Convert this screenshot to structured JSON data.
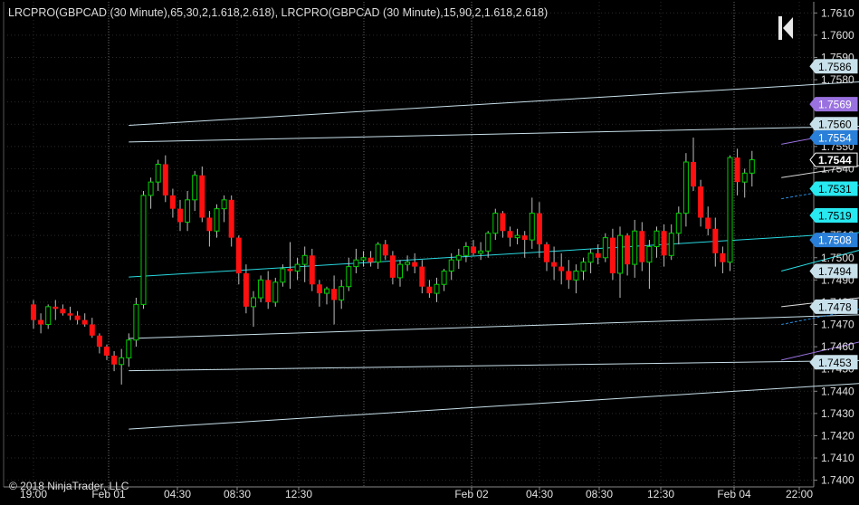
{
  "indicator_label": "LRCPRO(GBPCAD (30 Minute),65,30,2,1.618,2.618), LRCPRO(GBPCAD (30 Minute),15,90,2,1.618,2.618)",
  "copyright": "© 2018 NinjaTrader, LLC",
  "colors": {
    "background": "#000000",
    "grid": "#2a2a2a",
    "up_candle": "#00d000",
    "down_candle": "#ff1010",
    "long_channel": "#c8e0ea",
    "long_center": "#28d8e0",
    "short_outer": "#9a72e0",
    "short_inner": "#d8d8d8",
    "short_dashed": "#2a8ee0",
    "short_center": "#28e0e8"
  },
  "chart_data": {
    "type": "candlestick",
    "instrument": "GBPCAD",
    "timeframe": "30 Minute",
    "y_ticks": [
      "1.7610",
      "1.7600",
      "1.7590",
      "1.7580",
      "1.7570",
      "1.7560",
      "1.7550",
      "1.7540",
      "1.7530",
      "1.7520",
      "1.7510",
      "1.7500",
      "1.7490",
      "1.7480",
      "1.7470",
      "1.7460",
      "1.7450",
      "1.7440",
      "1.7430",
      "1.7420",
      "1.7410",
      "1.7400"
    ],
    "ylim": [
      1.7397,
      1.7615
    ],
    "x_ticks": [
      "19:00",
      "Feb 01",
      "04:30",
      "08:30",
      "12:30",
      "Feb 02",
      "04:30",
      "08:30",
      "12:30",
      "Feb 04",
      "22:00"
    ],
    "price_markers": [
      {
        "label": "1.7586",
        "value": 1.7586,
        "bg": "#c8e0ea",
        "fg": "#000000"
      },
      {
        "label": "1.7569",
        "value": 1.7569,
        "bg": "#9a72e0",
        "fg": "#ffffff"
      },
      {
        "label": "1.7560",
        "value": 1.756,
        "bg": "#c8e0ea",
        "fg": "#000000"
      },
      {
        "label": "1.7554",
        "value": 1.7554,
        "bg": "#2a7fd8",
        "fg": "#ffffff"
      },
      {
        "label": "1.7544",
        "value": 1.7544,
        "bg": "#000000",
        "fg": "#ffffff",
        "border": "#ffffff"
      },
      {
        "label": "1.7531",
        "value": 1.7531,
        "bg": "#28e8f0",
        "fg": "#000000"
      },
      {
        "label": "1.7519",
        "value": 1.7519,
        "bg": "#28e8f0",
        "fg": "#000000"
      },
      {
        "label": "1.7508",
        "value": 1.7508,
        "bg": "#2a7fd8",
        "fg": "#ffffff"
      },
      {
        "label": "1.7494",
        "value": 1.7494,
        "bg": "#c8e0ea",
        "fg": "#000000"
      },
      {
        "label": "1.7478",
        "value": 1.7478,
        "bg": "#c8e0ea",
        "fg": "#000000"
      },
      {
        "label": "1.7453",
        "value": 1.7453,
        "bg": "#c8e0ea",
        "fg": "#000000"
      }
    ],
    "channels": [
      {
        "name": "",
        "group": "long",
        "role": "upper2",
        "style": "solid",
        "from": [
          13,
          1.75595
        ],
        "to": [
          161,
          1.75885
        ]
      },
      {
        "name": "",
        "group": "long",
        "role": "upper1",
        "style": "solid",
        "from": [
          13,
          1.7552
        ],
        "to": [
          161,
          1.75625
        ]
      },
      {
        "name": "",
        "group": "long",
        "role": "center",
        "style": "solid",
        "from": [
          13,
          1.74913
        ],
        "to": [
          161,
          1.7521
        ]
      },
      {
        "name": "",
        "group": "long",
        "role": "lower1",
        "style": "solid",
        "from": [
          13,
          1.74637
        ],
        "to": [
          161,
          1.74795
        ]
      },
      {
        "name": "",
        "group": "long",
        "role": "lower2",
        "style": "solid",
        "from": [
          13,
          1.74492
        ],
        "to": [
          161,
          1.7456
        ]
      },
      {
        "name": "",
        "group": "long",
        "role": "lower3",
        "style": "solid",
        "from": [
          13,
          1.7423
        ],
        "to": [
          161,
          1.74534
        ]
      },
      {
        "name": "",
        "group": "short",
        "role": "upper_outer",
        "style": "solid",
        "from": [
          102,
          1.7551
        ],
        "to": [
          161,
          1.7588
        ]
      },
      {
        "name": "",
        "group": "short",
        "role": "upper_inner",
        "style": "solid",
        "from": [
          102,
          1.7536
        ],
        "to": [
          161,
          1.7566
        ]
      },
      {
        "name": "",
        "group": "short",
        "role": "upper_dashed",
        "style": "dashed",
        "from": [
          102,
          1.75265
        ],
        "to": [
          161,
          1.756
        ]
      },
      {
        "name": "",
        "group": "short",
        "role": "center",
        "style": "solid",
        "from": [
          102,
          1.7494
        ],
        "to": [
          161,
          1.7546
        ]
      },
      {
        "name": "",
        "group": "short",
        "role": "lower_dashed",
        "style": "dashed",
        "from": [
          102,
          1.747
        ],
        "to": [
          161,
          1.7508
        ]
      },
      {
        "name": "",
        "group": "short",
        "role": "lower_inner",
        "style": "solid",
        "from": [
          102,
          1.7478
        ],
        "to": [
          161,
          1.75
        ]
      },
      {
        "name": "",
        "group": "short",
        "role": "lower_outer",
        "style": "solid",
        "from": [
          102,
          1.7454
        ],
        "to": [
          161,
          1.7499
        ]
      }
    ],
    "candles": [
      {
        "o": 1.7479,
        "h": 1.7481,
        "l": 1.7468,
        "c": 1.7472
      },
      {
        "o": 1.7472,
        "h": 1.7475,
        "l": 1.7466,
        "c": 1.747
      },
      {
        "o": 1.747,
        "h": 1.7479,
        "l": 1.7468,
        "c": 1.7478
      },
      {
        "o": 1.7478,
        "h": 1.7481,
        "l": 1.7472,
        "c": 1.7477
      },
      {
        "o": 1.7477,
        "h": 1.7479,
        "l": 1.7474,
        "c": 1.7475
      },
      {
        "o": 1.7475,
        "h": 1.7478,
        "l": 1.7472,
        "c": 1.7474
      },
      {
        "o": 1.7474,
        "h": 1.7476,
        "l": 1.747,
        "c": 1.7472
      },
      {
        "o": 1.7472,
        "h": 1.7475,
        "l": 1.7469,
        "c": 1.747
      },
      {
        "o": 1.747,
        "h": 1.7473,
        "l": 1.7464,
        "c": 1.7465
      },
      {
        "o": 1.7465,
        "h": 1.7466,
        "l": 1.7457,
        "c": 1.746
      },
      {
        "o": 1.746,
        "h": 1.7461,
        "l": 1.7454,
        "c": 1.7456
      },
      {
        "o": 1.7456,
        "h": 1.7458,
        "l": 1.7449,
        "c": 1.7452
      },
      {
        "o": 1.7452,
        "h": 1.7459,
        "l": 1.7443,
        "c": 1.7455
      },
      {
        "o": 1.7455,
        "h": 1.7466,
        "l": 1.7451,
        "c": 1.7463
      },
      {
        "o": 1.7463,
        "h": 1.7482,
        "l": 1.746,
        "c": 1.7479
      },
      {
        "o": 1.7479,
        "h": 1.753,
        "l": 1.7477,
        "c": 1.7528
      },
      {
        "o": 1.7528,
        "h": 1.7536,
        "l": 1.7522,
        "c": 1.7534
      },
      {
        "o": 1.7534,
        "h": 1.7544,
        "l": 1.753,
        "c": 1.7542
      },
      {
        "o": 1.7542,
        "h": 1.7546,
        "l": 1.7525,
        "c": 1.7528
      },
      {
        "o": 1.7528,
        "h": 1.7531,
        "l": 1.7518,
        "c": 1.7522
      },
      {
        "o": 1.7522,
        "h": 1.7526,
        "l": 1.7512,
        "c": 1.7516
      },
      {
        "o": 1.7516,
        "h": 1.753,
        "l": 1.7512,
        "c": 1.7526
      },
      {
        "o": 1.7526,
        "h": 1.7539,
        "l": 1.7521,
        "c": 1.7537
      },
      {
        "o": 1.7537,
        "h": 1.7541,
        "l": 1.7516,
        "c": 1.7518
      },
      {
        "o": 1.7518,
        "h": 1.7521,
        "l": 1.7505,
        "c": 1.7512
      },
      {
        "o": 1.7512,
        "h": 1.7524,
        "l": 1.7509,
        "c": 1.7522
      },
      {
        "o": 1.7522,
        "h": 1.7528,
        "l": 1.7516,
        "c": 1.7526
      },
      {
        "o": 1.7526,
        "h": 1.7528,
        "l": 1.7505,
        "c": 1.7509
      },
      {
        "o": 1.7509,
        "h": 1.751,
        "l": 1.7488,
        "c": 1.7493
      },
      {
        "o": 1.7493,
        "h": 1.7497,
        "l": 1.7475,
        "c": 1.7478
      },
      {
        "o": 1.7478,
        "h": 1.7485,
        "l": 1.7469,
        "c": 1.7482
      },
      {
        "o": 1.7482,
        "h": 1.7492,
        "l": 1.748,
        "c": 1.749
      },
      {
        "o": 1.749,
        "h": 1.7494,
        "l": 1.7477,
        "c": 1.748
      },
      {
        "o": 1.748,
        "h": 1.7491,
        "l": 1.7478,
        "c": 1.7489
      },
      {
        "o": 1.7489,
        "h": 1.7497,
        "l": 1.7487,
        "c": 1.7495
      },
      {
        "o": 1.7495,
        "h": 1.7507,
        "l": 1.7486,
        "c": 1.7494
      },
      {
        "o": 1.7494,
        "h": 1.75,
        "l": 1.749,
        "c": 1.7497
      },
      {
        "o": 1.7497,
        "h": 1.7505,
        "l": 1.7489,
        "c": 1.7501
      },
      {
        "o": 1.7501,
        "h": 1.7504,
        "l": 1.7485,
        "c": 1.7488
      },
      {
        "o": 1.7488,
        "h": 1.749,
        "l": 1.7478,
        "c": 1.7484
      },
      {
        "o": 1.7484,
        "h": 1.7487,
        "l": 1.7479,
        "c": 1.7486
      },
      {
        "o": 1.7486,
        "h": 1.7492,
        "l": 1.747,
        "c": 1.7481
      },
      {
        "o": 1.7481,
        "h": 1.749,
        "l": 1.7477,
        "c": 1.7487
      },
      {
        "o": 1.7487,
        "h": 1.75,
        "l": 1.7485,
        "c": 1.7496
      },
      {
        "o": 1.7496,
        "h": 1.7504,
        "l": 1.7493,
        "c": 1.7499
      },
      {
        "o": 1.7499,
        "h": 1.7503,
        "l": 1.7496,
        "c": 1.75
      },
      {
        "o": 1.75,
        "h": 1.7503,
        "l": 1.7496,
        "c": 1.7498
      },
      {
        "o": 1.7498,
        "h": 1.7507,
        "l": 1.7495,
        "c": 1.7506
      },
      {
        "o": 1.7506,
        "h": 1.7508,
        "l": 1.7499,
        "c": 1.7501
      },
      {
        "o": 1.7501,
        "h": 1.7503,
        "l": 1.7488,
        "c": 1.7491
      },
      {
        "o": 1.7491,
        "h": 1.7499,
        "l": 1.7487,
        "c": 1.7497
      },
      {
        "o": 1.7497,
        "h": 1.7501,
        "l": 1.7494,
        "c": 1.7498
      },
      {
        "o": 1.7498,
        "h": 1.7502,
        "l": 1.7493,
        "c": 1.7496
      },
      {
        "o": 1.7496,
        "h": 1.7499,
        "l": 1.7484,
        "c": 1.7487
      },
      {
        "o": 1.7487,
        "h": 1.749,
        "l": 1.7482,
        "c": 1.7484
      },
      {
        "o": 1.7484,
        "h": 1.7491,
        "l": 1.748,
        "c": 1.7488
      },
      {
        "o": 1.7488,
        "h": 1.7495,
        "l": 1.7485,
        "c": 1.7494
      },
      {
        "o": 1.7494,
        "h": 1.7502,
        "l": 1.749,
        "c": 1.7499
      },
      {
        "o": 1.7499,
        "h": 1.7504,
        "l": 1.7495,
        "c": 1.7501
      },
      {
        "o": 1.7501,
        "h": 1.7507,
        "l": 1.7498,
        "c": 1.7505
      },
      {
        "o": 1.7505,
        "h": 1.7508,
        "l": 1.7501,
        "c": 1.7502
      },
      {
        "o": 1.7502,
        "h": 1.7507,
        "l": 1.7499,
        "c": 1.7503
      },
      {
        "o": 1.7503,
        "h": 1.7512,
        "l": 1.75,
        "c": 1.7511
      },
      {
        "o": 1.7511,
        "h": 1.7522,
        "l": 1.7508,
        "c": 1.752
      },
      {
        "o": 1.752,
        "h": 1.7521,
        "l": 1.7509,
        "c": 1.7512
      },
      {
        "o": 1.7512,
        "h": 1.7514,
        "l": 1.7505,
        "c": 1.7509
      },
      {
        "o": 1.7509,
        "h": 1.7513,
        "l": 1.7506,
        "c": 1.751
      },
      {
        "o": 1.751,
        "h": 1.7512,
        "l": 1.75,
        "c": 1.7508
      },
      {
        "o": 1.7508,
        "h": 1.7527,
        "l": 1.7504,
        "c": 1.752
      },
      {
        "o": 1.752,
        "h": 1.7525,
        "l": 1.75,
        "c": 1.7506
      },
      {
        "o": 1.7506,
        "h": 1.7507,
        "l": 1.7494,
        "c": 1.7498
      },
      {
        "o": 1.7498,
        "h": 1.7505,
        "l": 1.749,
        "c": 1.7496
      },
      {
        "o": 1.7496,
        "h": 1.7502,
        "l": 1.7488,
        "c": 1.7494
      },
      {
        "o": 1.7494,
        "h": 1.7499,
        "l": 1.7486,
        "c": 1.749
      },
      {
        "o": 1.749,
        "h": 1.7497,
        "l": 1.7484,
        "c": 1.7494
      },
      {
        "o": 1.7494,
        "h": 1.75,
        "l": 1.749,
        "c": 1.7498
      },
      {
        "o": 1.7498,
        "h": 1.7504,
        "l": 1.7493,
        "c": 1.7502
      },
      {
        "o": 1.7502,
        "h": 1.7506,
        "l": 1.7497,
        "c": 1.75
      },
      {
        "o": 1.75,
        "h": 1.7511,
        "l": 1.7498,
        "c": 1.7509
      },
      {
        "o": 1.7509,
        "h": 1.7513,
        "l": 1.749,
        "c": 1.7493
      },
      {
        "o": 1.7493,
        "h": 1.7514,
        "l": 1.7482,
        "c": 1.751
      },
      {
        "o": 1.751,
        "h": 1.7511,
        "l": 1.7492,
        "c": 1.7497
      },
      {
        "o": 1.7497,
        "h": 1.7517,
        "l": 1.7491,
        "c": 1.7512
      },
      {
        "o": 1.7512,
        "h": 1.7516,
        "l": 1.7494,
        "c": 1.7498
      },
      {
        "o": 1.7498,
        "h": 1.7508,
        "l": 1.7486,
        "c": 1.7505
      },
      {
        "o": 1.7505,
        "h": 1.7514,
        "l": 1.75,
        "c": 1.7512
      },
      {
        "o": 1.7512,
        "h": 1.7515,
        "l": 1.7496,
        "c": 1.7501
      },
      {
        "o": 1.7501,
        "h": 1.7515,
        "l": 1.7499,
        "c": 1.7511
      },
      {
        "o": 1.7511,
        "h": 1.7523,
        "l": 1.7506,
        "c": 1.752
      },
      {
        "o": 1.752,
        "h": 1.7547,
        "l": 1.7514,
        "c": 1.7543
      },
      {
        "o": 1.7543,
        "h": 1.7554,
        "l": 1.753,
        "c": 1.7532
      },
      {
        "o": 1.7532,
        "h": 1.7535,
        "l": 1.7514,
        "c": 1.7518
      },
      {
        "o": 1.7518,
        "h": 1.7523,
        "l": 1.751,
        "c": 1.7513
      },
      {
        "o": 1.7513,
        "h": 1.7518,
        "l": 1.7496,
        "c": 1.7502
      },
      {
        "o": 1.7502,
        "h": 1.7505,
        "l": 1.7493,
        "c": 1.7498
      },
      {
        "o": 1.7498,
        "h": 1.7546,
        "l": 1.7494,
        "c": 1.7545
      },
      {
        "o": 1.7545,
        "h": 1.7549,
        "l": 1.7528,
        "c": 1.7534
      },
      {
        "o": 1.7534,
        "h": 1.754,
        "l": 1.7527,
        "c": 1.7538
      },
      {
        "o": 1.7538,
        "h": 1.7548,
        "l": 1.7532,
        "c": 1.7544
      }
    ]
  }
}
